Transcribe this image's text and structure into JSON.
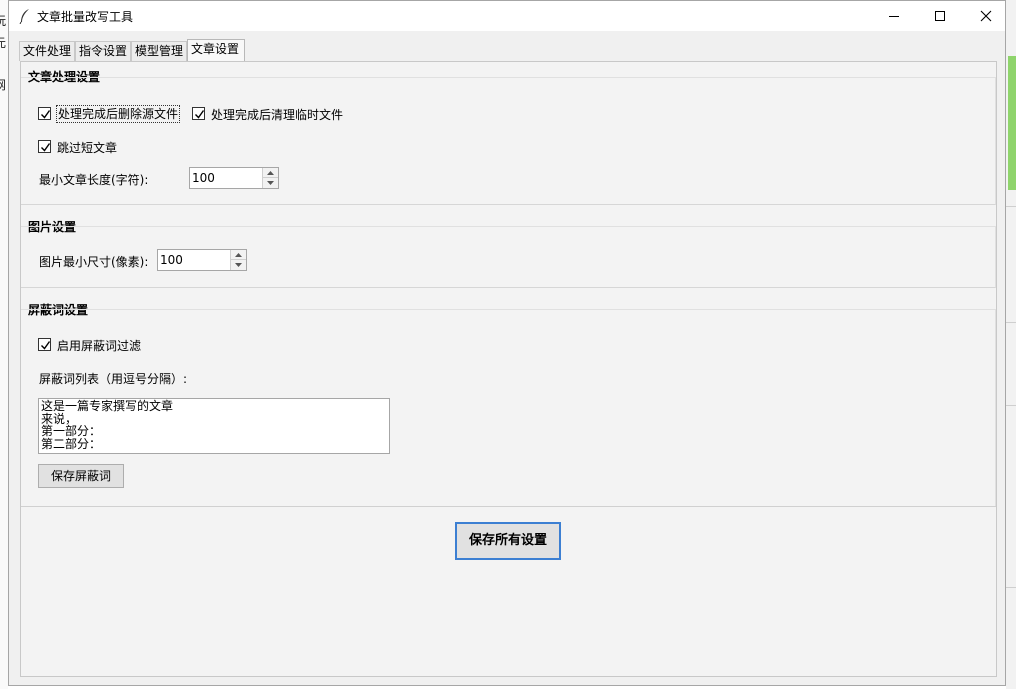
{
  "window": {
    "title": "文章批量改写工具",
    "icon": "feather-icon"
  },
  "tabs": [
    {
      "label": "文件处理",
      "active": false
    },
    {
      "label": "指令设置",
      "active": false
    },
    {
      "label": "模型管理",
      "active": false
    },
    {
      "label": "文章设置",
      "active": true
    }
  ],
  "article_settings": {
    "title": "文章处理设置",
    "delete_source": {
      "label": "处理完成后删除源文件",
      "checked": true
    },
    "clean_temp": {
      "label": "处理完成后清理临时文件",
      "checked": true
    },
    "skip_short": {
      "label": "跳过短文章",
      "checked": true
    },
    "min_length": {
      "label": "最小文章长度(字符):",
      "value": "100"
    }
  },
  "image_settings": {
    "title": "图片设置",
    "min_size": {
      "label": "图片最小尺寸(像素):",
      "value": "100"
    }
  },
  "blocked_settings": {
    "title": "屏蔽词设置",
    "enable_filter": {
      "label": "启用屏蔽词过滤",
      "checked": true
    },
    "list_label": "屏蔽词列表（用逗号分隔）:",
    "lines": [
      "这是一篇专家撰写的文章",
      "来说，",
      "第一部分：",
      "第二部分："
    ],
    "save_button": "保存屏蔽词"
  },
  "save_all_button": "保存所有设置",
  "background_fragments": [
    "玩",
    "元",
    "网"
  ]
}
